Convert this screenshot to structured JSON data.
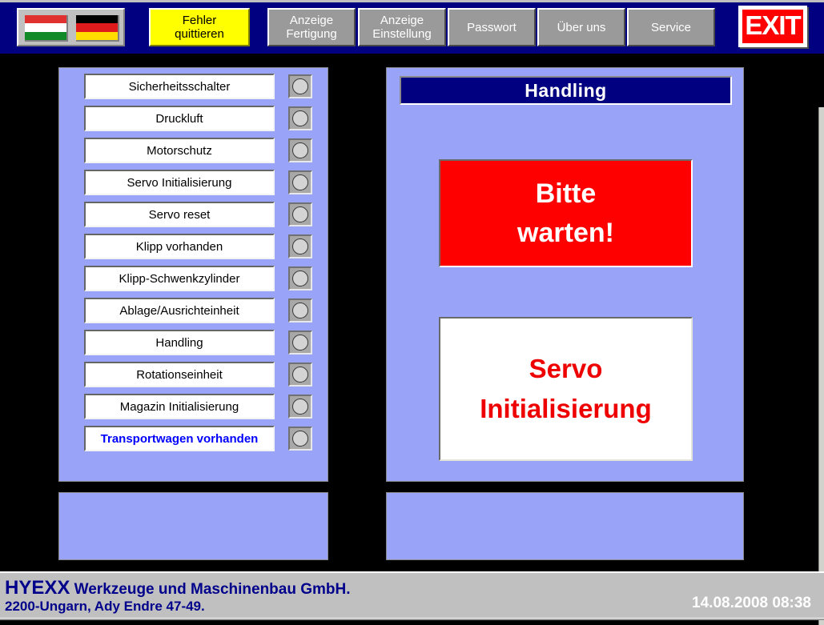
{
  "topbar": {
    "flags": [
      {
        "name": "hungary",
        "stripes": [
          "#e03030",
          "#ffffff",
          "#128a28"
        ]
      },
      {
        "name": "germany",
        "stripes": [
          "#000000",
          "#e01b1b",
          "#ffdd00"
        ]
      }
    ],
    "buttons": [
      {
        "id": "acknowledge-fault",
        "label": "Fehler\nquittieren",
        "style": "alarm"
      },
      {
        "id": "display-production",
        "label": "Anzeige\nFertigung",
        "style": "normal"
      },
      {
        "id": "display-settings",
        "label": "Anzeige\nEinstellung",
        "style": "normal"
      },
      {
        "id": "password",
        "label": "Passwort",
        "style": "normal"
      },
      {
        "id": "about-us",
        "label": "Über uns",
        "style": "normal"
      },
      {
        "id": "service",
        "label": "Service",
        "style": "normal"
      }
    ],
    "exit_label": "EXIT"
  },
  "status_list": [
    {
      "label": "Sicherheitsschalter",
      "lamp": "off",
      "text_color": "black"
    },
    {
      "label": "Druckluft",
      "lamp": "off",
      "text_color": "black"
    },
    {
      "label": "Motorschutz",
      "lamp": "off",
      "text_color": "black"
    },
    {
      "label": "Servo Initialisierung",
      "lamp": "off",
      "text_color": "black"
    },
    {
      "label": "Servo reset",
      "lamp": "off",
      "text_color": "black"
    },
    {
      "label": "Klipp vorhanden",
      "lamp": "off",
      "text_color": "black"
    },
    {
      "label": "Klipp-Schwenkzylinder",
      "lamp": "off",
      "text_color": "black"
    },
    {
      "label": "Ablage/Ausrichteinheit",
      "lamp": "off",
      "text_color": "black"
    },
    {
      "label": "Handling",
      "lamp": "off",
      "text_color": "black"
    },
    {
      "label": "Rotationseinheit",
      "lamp": "off",
      "text_color": "black"
    },
    {
      "label": "Magazin Initialisierung",
      "lamp": "off",
      "text_color": "black"
    },
    {
      "label": "Transportwagen vorhanden",
      "lamp": "off",
      "text_color": "blue"
    }
  ],
  "right_panel": {
    "header": "Handling",
    "wait_message_line1": "Bitte",
    "wait_message_line2": "warten!",
    "state_message_line1": "Servo",
    "state_message_line2": "Initialisierung"
  },
  "statusbar": {
    "company_brand": "HYEXX",
    "company_rest": " Werkzeuge und Maschinenbau GmbH.",
    "company_address": "2200-Ungarn, Ady Endre 47-49.",
    "datetime": "14.08.2008 08:38"
  },
  "colors": {
    "topbar_bg": "#000080",
    "panel_bg": "#99a3f7",
    "alarm_yellow": "#ffff00",
    "alert_red": "#ff0000",
    "header_navy": "#000080",
    "brand_navy": "#00008b",
    "canvas_black": "#000000"
  }
}
